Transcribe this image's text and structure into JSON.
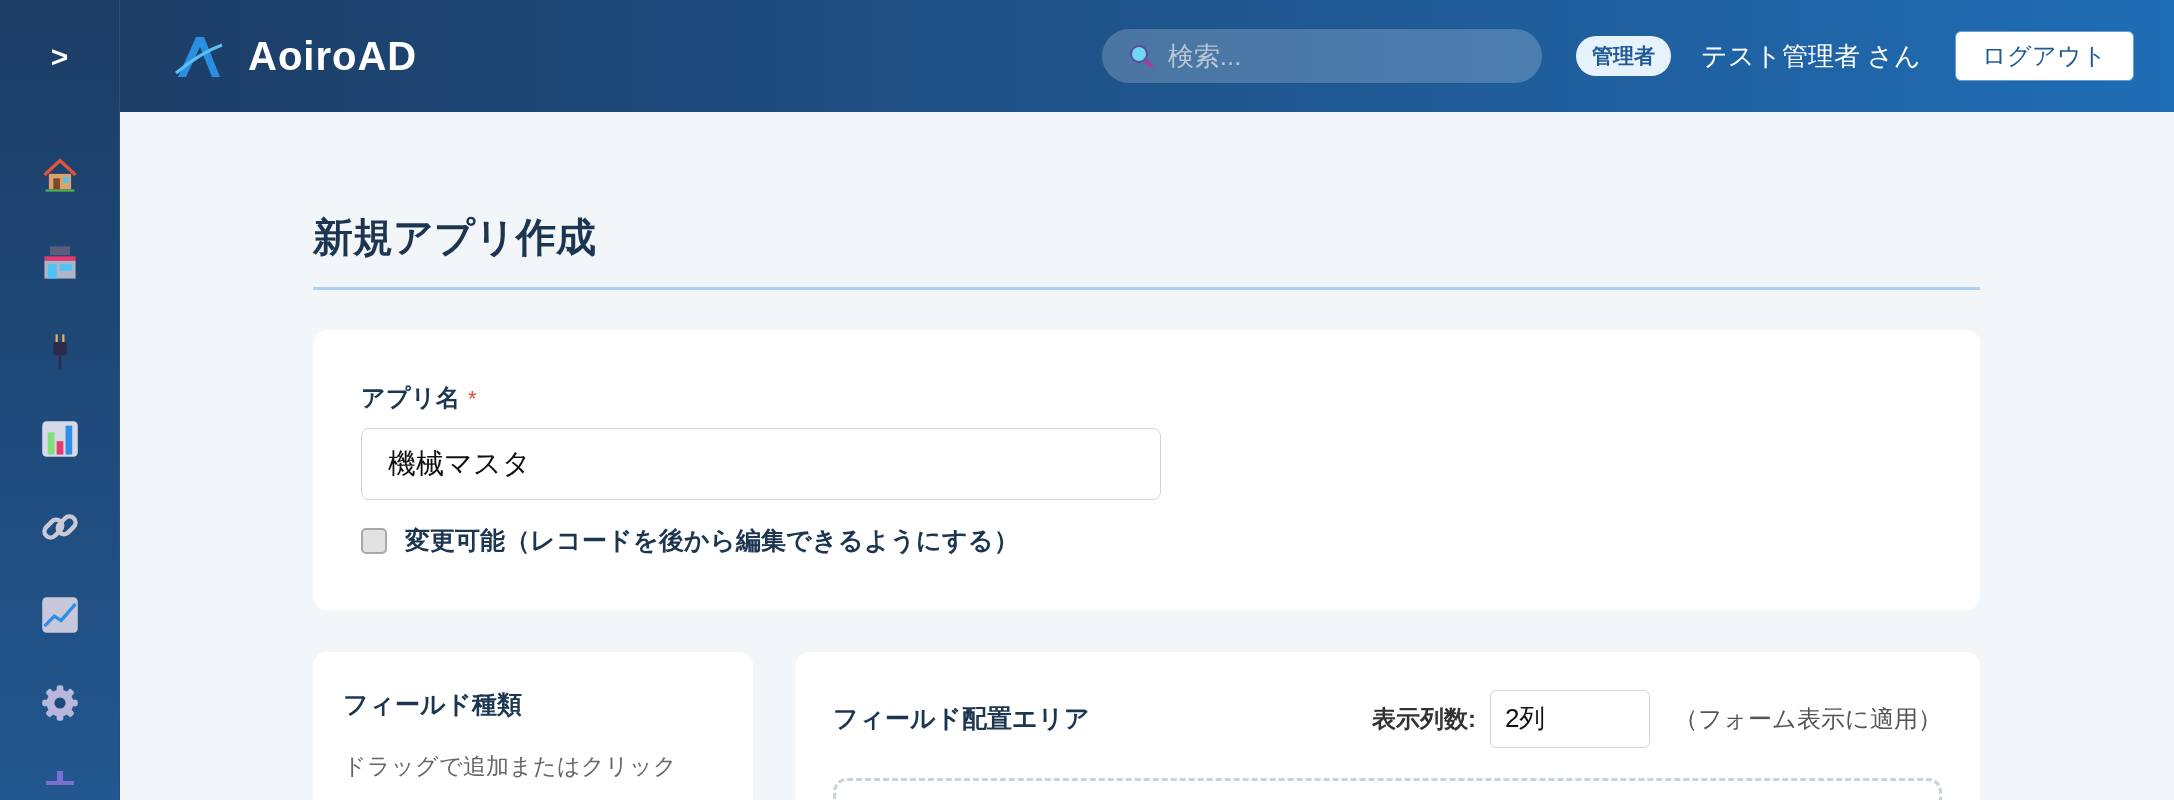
{
  "sidebar": {
    "toggle": ">",
    "items": [
      {
        "kind": "home"
      },
      {
        "kind": "store"
      },
      {
        "kind": "plug"
      },
      {
        "kind": "bars"
      },
      {
        "kind": "link"
      },
      {
        "kind": "trend"
      },
      {
        "kind": "gear"
      },
      {
        "kind": "plus"
      }
    ]
  },
  "header": {
    "brand": "AoiroAD",
    "search": {
      "placeholder": "検索..."
    },
    "role_badge": "管理者",
    "user": "テスト管理者 さん",
    "logout": "ログアウト"
  },
  "page_title": "新規アプリ作成",
  "app_form": {
    "label": "アプリ名",
    "required_mark": "*",
    "value": "機械マスタ",
    "editable": {
      "label": "変更可能（レコードを後から編集できるようにする）",
      "checked": false
    }
  },
  "field_types": {
    "title": "フィールド種類",
    "hint": "ドラッグで追加またはクリック"
  },
  "layout_area": {
    "title": "フィールド配置エリア",
    "columns_label": "表示列数:",
    "columns_value": "2列",
    "columns_note": "（フォーム表示に適用）"
  }
}
